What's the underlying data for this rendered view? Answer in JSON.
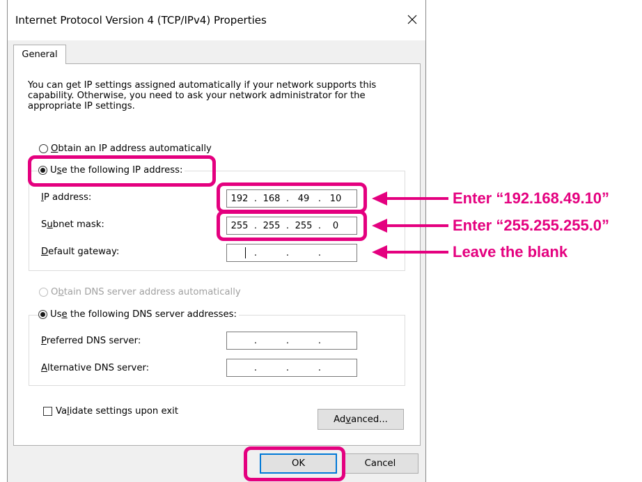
{
  "dialog": {
    "title": "Internet Protocol Version 4 (TCP/IPv4) Properties",
    "close_icon": "close-icon"
  },
  "tab": {
    "label": "General"
  },
  "intro_text": "You can get IP settings assigned automatically if your network supports this capability. Otherwise, you need to ask your network administrator for the appropriate IP settings.",
  "ip_section": {
    "auto_option": {
      "label": "Obtain an IP address automatically",
      "selected": false
    },
    "manual_option": {
      "label": "Use the following IP address:",
      "selected": true
    },
    "fields": {
      "ip_address": {
        "label": "IP address:",
        "octets": [
          "192",
          "168",
          "49",
          "10"
        ]
      },
      "subnet_mask": {
        "label": "Subnet mask:",
        "octets": [
          "255",
          "255",
          "255",
          "0"
        ]
      },
      "default_gateway": {
        "label": "Default gateway:",
        "octets": [
          "",
          "",
          "",
          ""
        ]
      }
    }
  },
  "dns_section": {
    "auto_option": {
      "label": "Obtain DNS server address automatically",
      "selected": false,
      "disabled": true
    },
    "manual_option": {
      "label": "Use the following DNS server addresses:",
      "selected": true
    },
    "fields": {
      "preferred": {
        "label": "Preferred DNS server:",
        "octets": [
          "",
          "",
          "",
          ""
        ]
      },
      "alternative": {
        "label": "Alternative DNS server:",
        "octets": [
          "",
          "",
          "",
          ""
        ]
      }
    }
  },
  "validate_checkbox": {
    "label": "Validate settings upon exit",
    "checked": false
  },
  "buttons": {
    "advanced": "Advanced...",
    "ok": "OK",
    "cancel": "Cancel"
  },
  "annotations": {
    "ip_note": "Enter “192.168.49.10”",
    "subnet_note": "Enter “255.255.255.0”",
    "gateway_note": "Leave the blank",
    "highlight_color": "#e4007f"
  },
  "colors": {
    "dialog_bg": "#f0f0f0",
    "panel_bg": "#ffffff",
    "button_bg": "#e1e1e1",
    "focus_border": "#0078d7"
  }
}
